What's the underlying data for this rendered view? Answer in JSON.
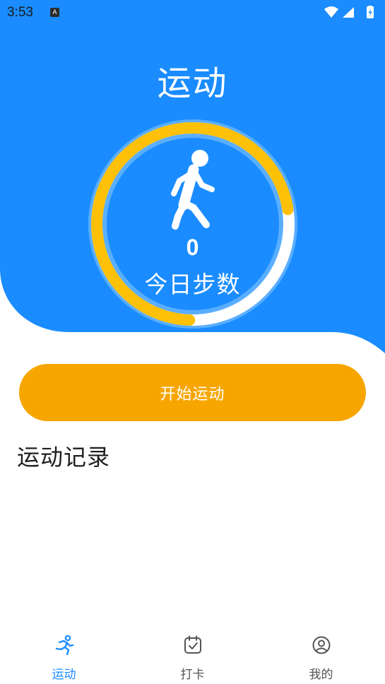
{
  "status_bar": {
    "time": "3:53",
    "notification_icon_letter": "A"
  },
  "header": {
    "title": "运动"
  },
  "steps": {
    "count": "0",
    "label": "今日步数",
    "progress_fraction": 0.72
  },
  "colors": {
    "primary_blue": "#1a8cff",
    "accent_orange": "#f7a600",
    "ring_yellow": "#ffc107",
    "nav_active": "#1a8cff",
    "nav_inactive": "#555555"
  },
  "actions": {
    "start_label": "开始运动"
  },
  "records": {
    "title": "运动记录"
  },
  "nav": {
    "items": [
      {
        "label": "运动",
        "icon": "running-icon",
        "active": true
      },
      {
        "label": "打卡",
        "icon": "calendar-check-icon",
        "active": false
      },
      {
        "label": "我的",
        "icon": "user-icon",
        "active": false
      }
    ]
  }
}
